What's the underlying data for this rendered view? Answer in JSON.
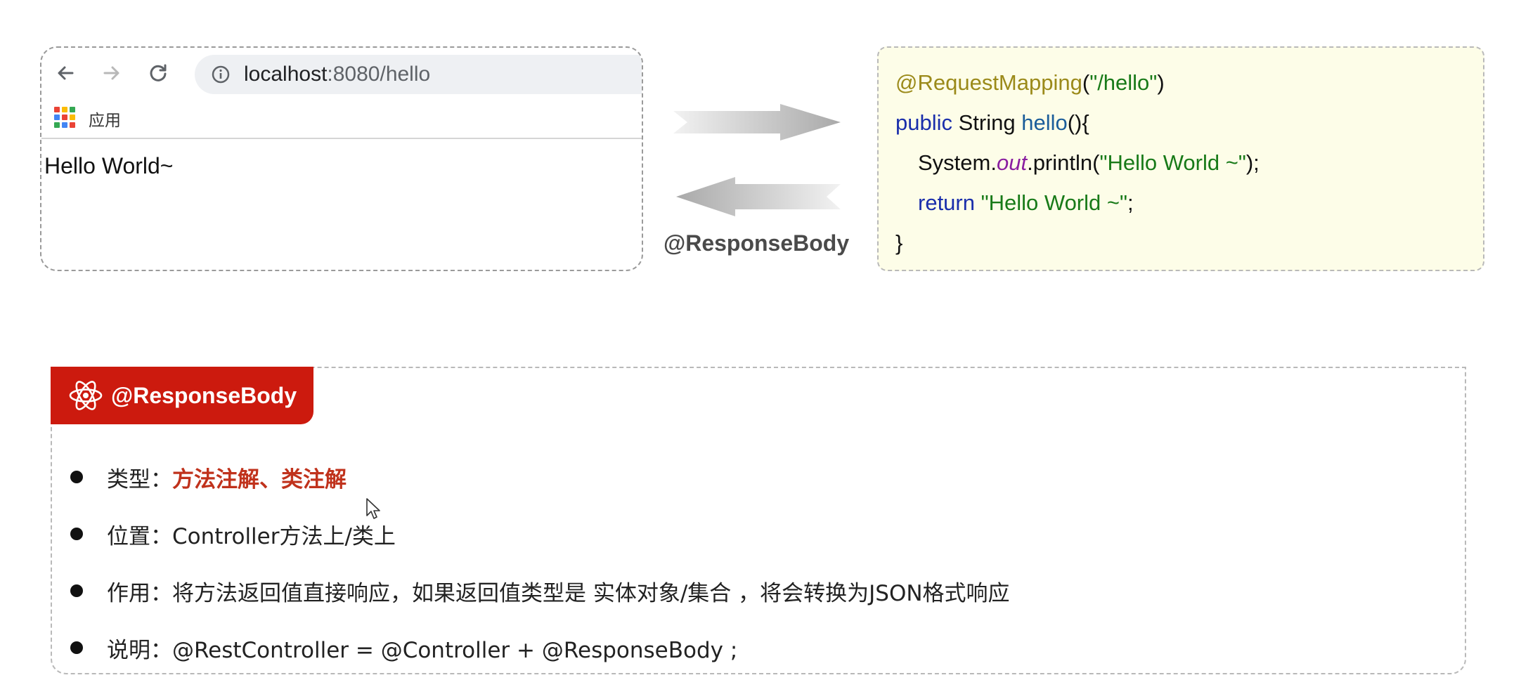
{
  "browser": {
    "url_host": "localhost",
    "url_rest": ":8080/hello",
    "bookmark_label": "应用",
    "page_text": "Hello World~",
    "apps_colors": [
      "#ea4335",
      "#fbbc05",
      "#34a853",
      "#4285f4",
      "#ea4335",
      "#fbbc05",
      "#34a853",
      "#4285f4",
      "#ea4335"
    ]
  },
  "diagram": {
    "caption": "@ResponseBody"
  },
  "code": {
    "l1_annotation": "@RequestMapping",
    "l1_open": "(",
    "l1_string": "\"/hello\"",
    "l1_close": ")",
    "l2_kw": "public",
    "l2_type": " String ",
    "l2_fn": "hello",
    "l2_rest": "(){",
    "l3_pre": "System.",
    "l3_out": "out",
    "l3_mid": ".println(",
    "l3_string": "\"Hello World ~\"",
    "l3_end": ");",
    "l4_kw": "return ",
    "l4_string": "\"Hello World ~\"",
    "l4_end": ";",
    "l5": "}"
  },
  "card": {
    "title": "@ResponseBody",
    "items": [
      {
        "label": "类型：",
        "value": "方法注解、类注解"
      },
      {
        "label": "位置：",
        "value": "Controller方法上/类上"
      },
      {
        "label": "作用：",
        "value": "将方法返回值直接响应，如果返回值类型是 实体对象/集合 ，将会转换为JSON格式响应"
      },
      {
        "label": "说明：",
        "value": "@RestController = @Controller + @ResponseBody ;"
      }
    ]
  }
}
